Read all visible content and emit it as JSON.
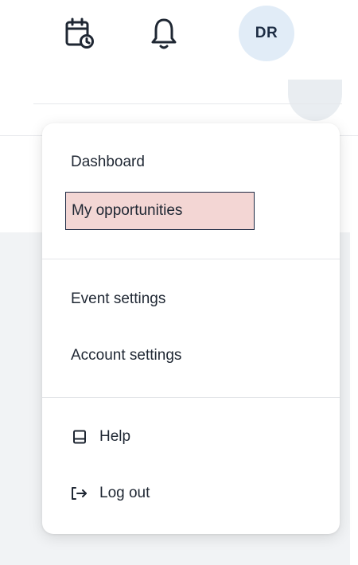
{
  "header": {
    "calendar_icon": "calendar-clock-icon",
    "bell_icon": "bell-icon",
    "avatar_initials": "DR"
  },
  "menu": {
    "items": [
      {
        "label": "Dashboard"
      },
      {
        "label": "My opportunities",
        "highlighted": true
      },
      {
        "label": "Event settings"
      },
      {
        "label": "Account settings"
      },
      {
        "label": "Help",
        "icon": "book-icon"
      },
      {
        "label": "Log out",
        "icon": "logout-icon"
      }
    ]
  },
  "colors": {
    "avatar_bg": "#e1ecf7",
    "highlight_bg": "#f3d6d4",
    "highlight_border": "#1e2a44",
    "panel_bg": "#f1f3f5"
  }
}
